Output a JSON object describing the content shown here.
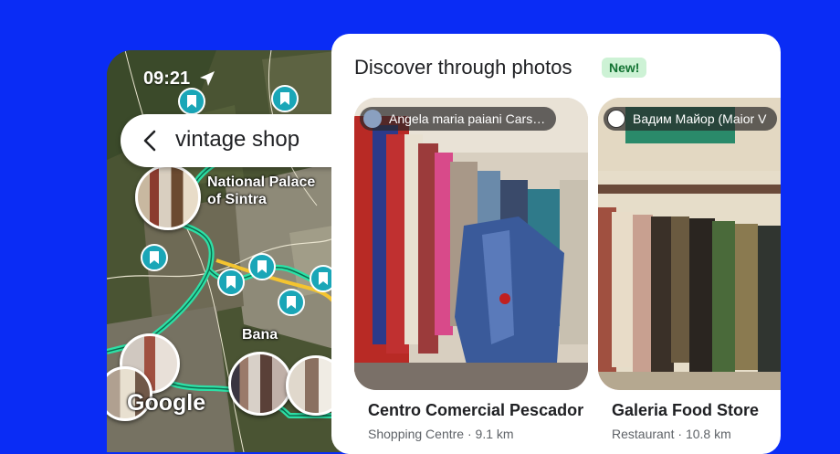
{
  "colors": {
    "background": "#0a2cf5",
    "route": "#2de0a6",
    "pin": "#1aa6b7",
    "new_badge_bg": "#cdf2d5",
    "new_badge_text": "#137333"
  },
  "map": {
    "status_time": "09:21",
    "navigation_icon": "navigation-arrow-icon",
    "search": {
      "back_icon": "back-arrow-icon",
      "query": "vintage shop"
    },
    "labels": {
      "palace": "National Palace\nof Sintra",
      "town": "Bana"
    },
    "logo": "Google"
  },
  "discover": {
    "title": "Discover through photos",
    "badge": "New!",
    "places": [
      {
        "credit": "Angela maria paiani Cars…",
        "name": "Centro Comercial Pescador",
        "category": "Shopping Centre",
        "distance": "9.1 km"
      },
      {
        "credit": "Вадим Майор (Maior V",
        "name": "Galeria Food Store",
        "category": "Restaurant",
        "distance": "10.8 km"
      }
    ]
  }
}
